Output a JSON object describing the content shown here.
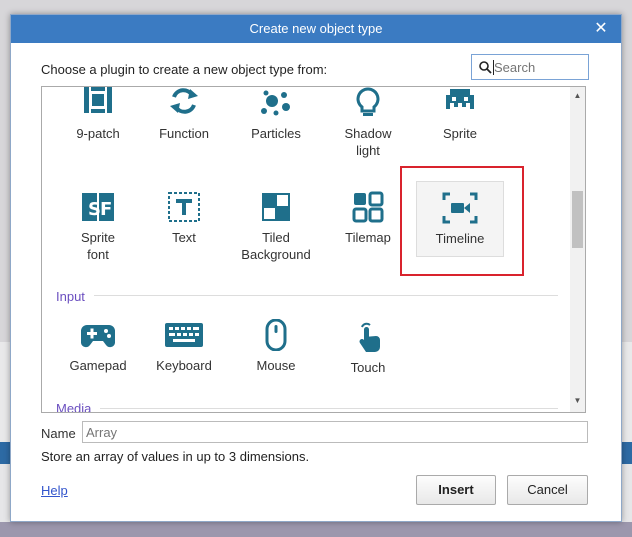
{
  "dialog": {
    "title": "Create new object type",
    "prompt": "Choose a plugin to create a new object type from:",
    "search_placeholder": "Search",
    "name_label": "Name",
    "name_placeholder": "Array",
    "description": "Store an array of values in up to 3 dimensions.",
    "help_label": "Help",
    "insert_label": "Insert",
    "cancel_label": "Cancel"
  },
  "plugins_row1": [
    {
      "label": "9-patch",
      "icon": "nine-patch-icon"
    },
    {
      "label": "Function",
      "icon": "function-icon"
    },
    {
      "label": "Particles",
      "icon": "particles-icon"
    },
    {
      "label": "Shadow light",
      "icon": "lightbulb-icon"
    },
    {
      "label": "Sprite",
      "icon": "sprite-invader-icon"
    }
  ],
  "plugins_row2": [
    {
      "label": "Sprite font",
      "icon": "sprite-font-icon"
    },
    {
      "label": "Text",
      "icon": "text-icon"
    },
    {
      "label": "Tiled Background",
      "icon": "tiled-background-icon"
    },
    {
      "label": "Tilemap",
      "icon": "tilemap-icon"
    },
    {
      "label": "Timeline",
      "icon": "timeline-camera-icon",
      "selected": true
    }
  ],
  "sections": {
    "input": "Input",
    "media": "Media"
  },
  "plugins_input": [
    {
      "label": "Gamepad",
      "icon": "gamepad-icon"
    },
    {
      "label": "Keyboard",
      "icon": "keyboard-icon"
    },
    {
      "label": "Mouse",
      "icon": "mouse-icon"
    },
    {
      "label": "Touch",
      "icon": "touch-icon"
    }
  ],
  "colors": {
    "titlebar": "#3b7bc2",
    "icon": "#1f6f8b",
    "section": "#6b4fc0",
    "highlight": "#d9232d"
  }
}
